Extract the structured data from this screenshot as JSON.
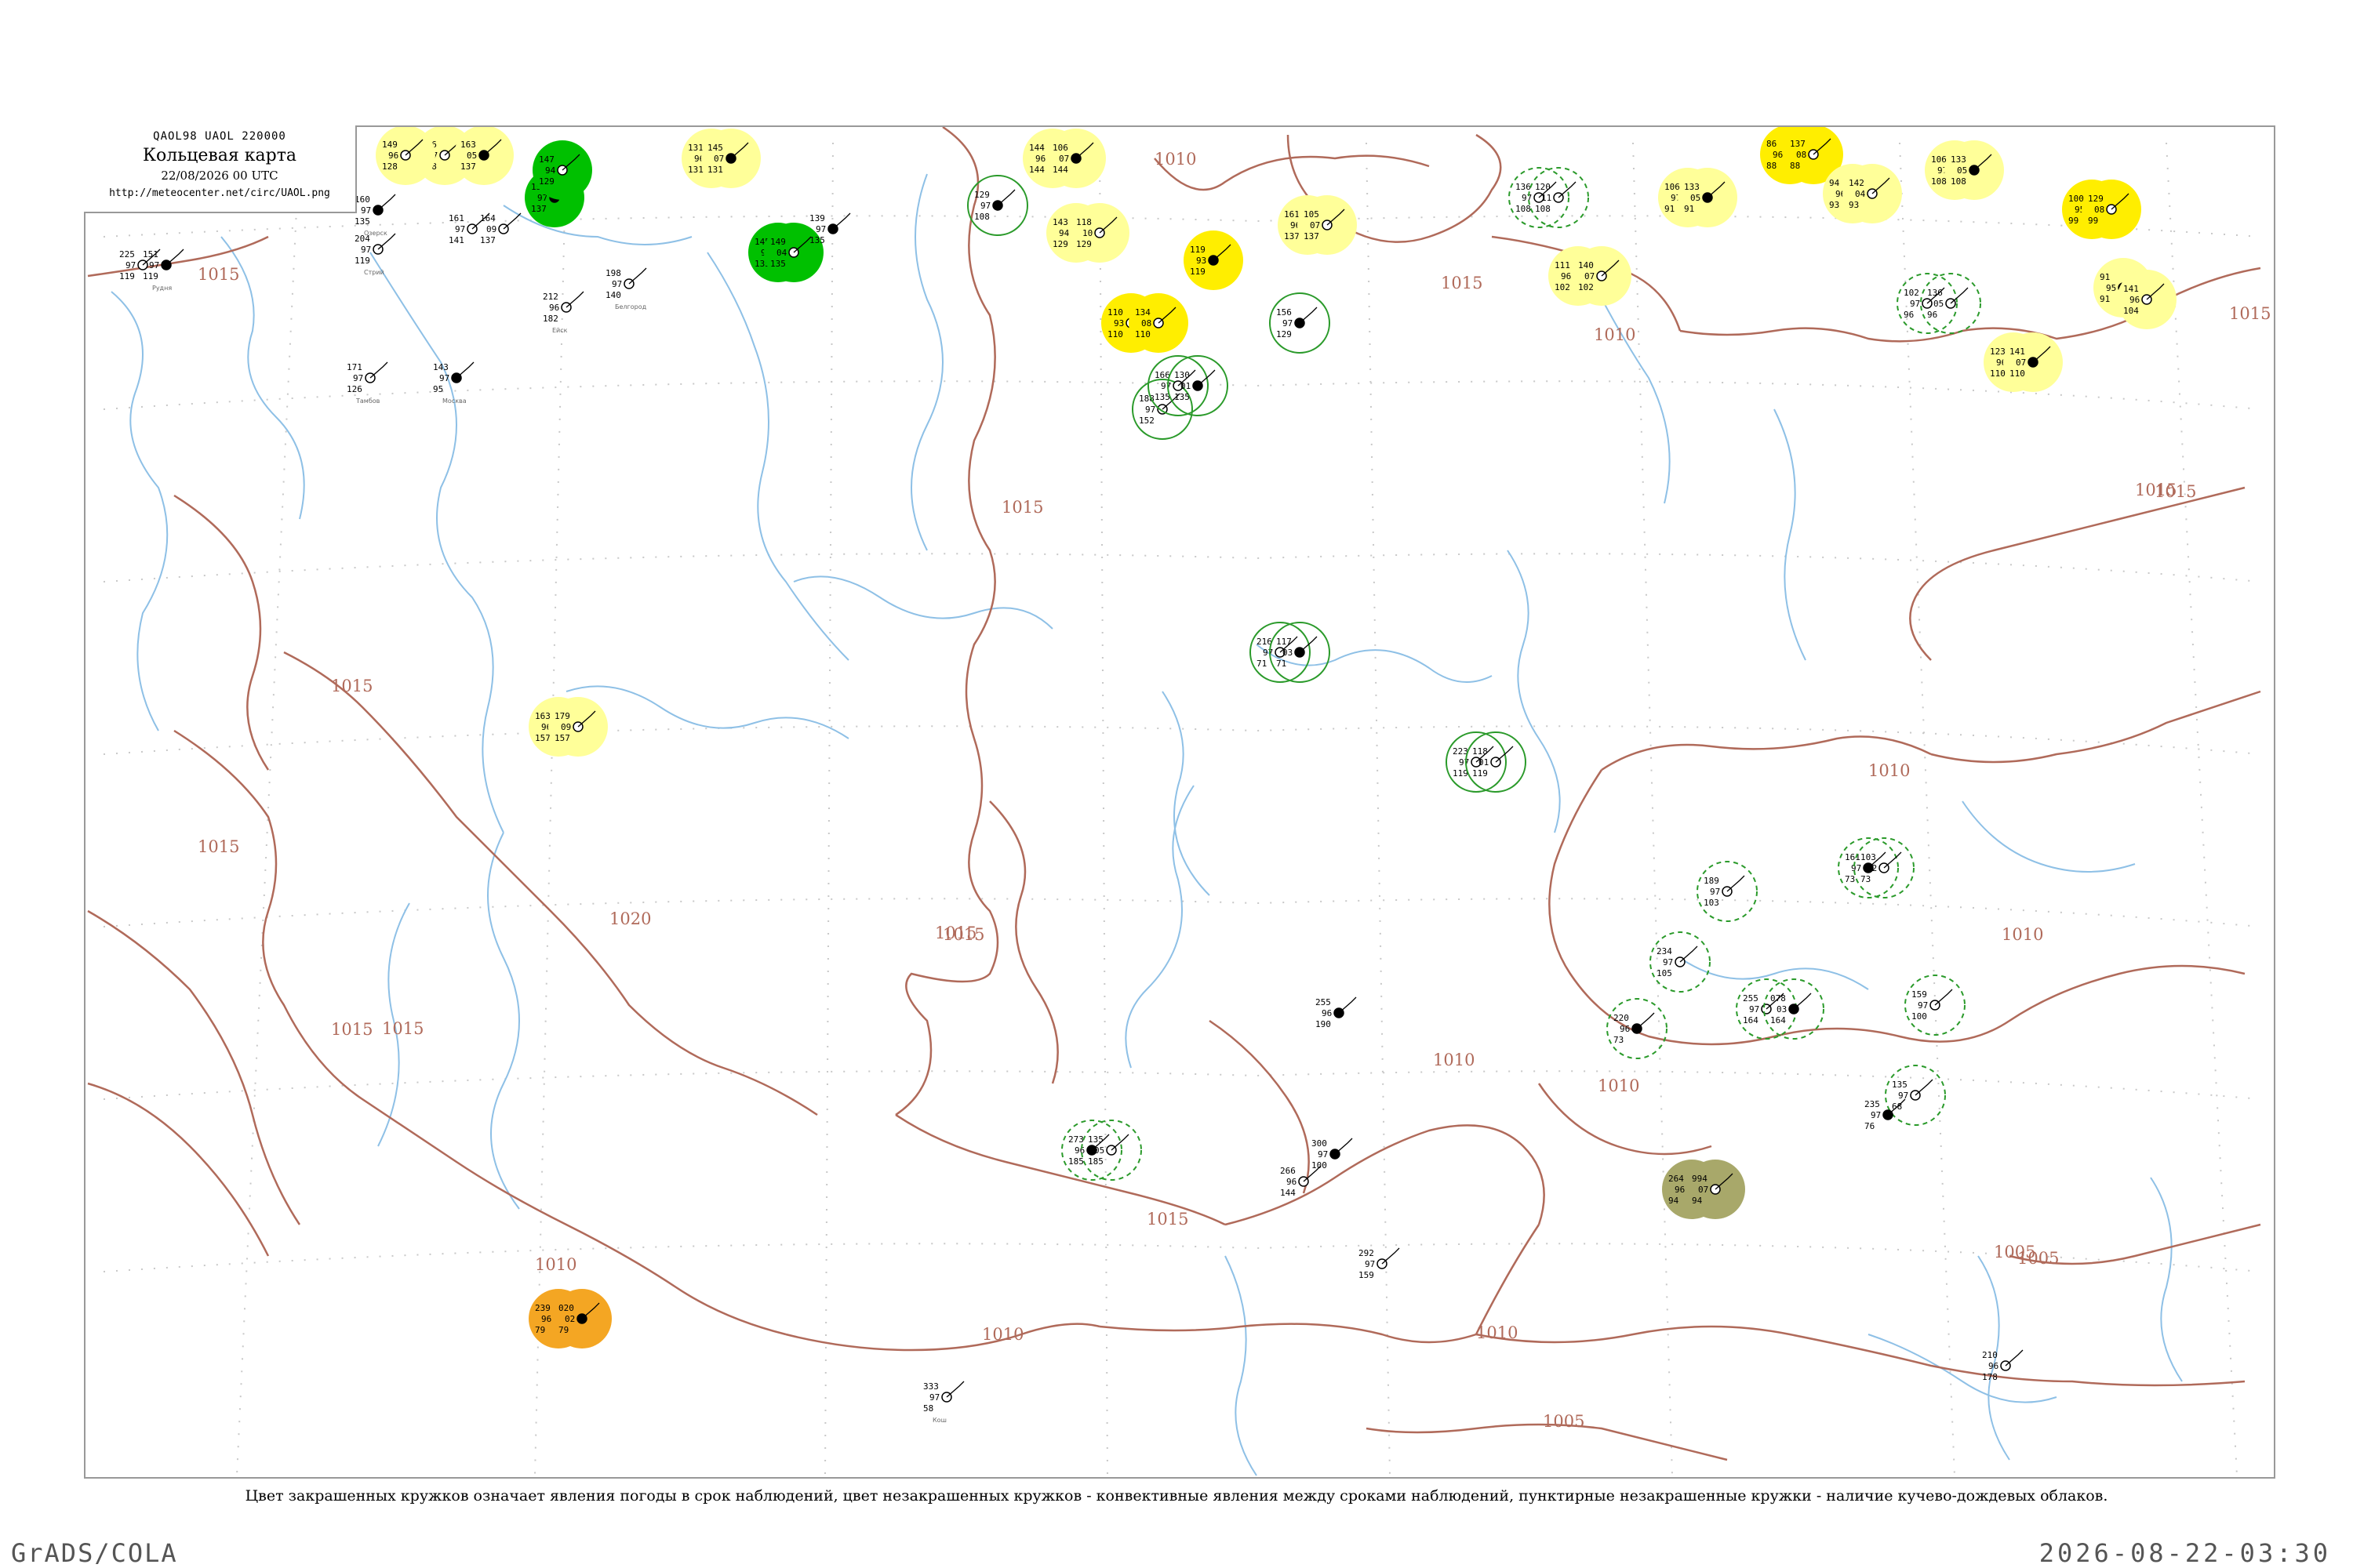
{
  "header": {
    "codes": "QAOL98  UAOL  220000",
    "title": "Кольцевая карта",
    "time": "22/08/2026 00 UTC",
    "url": "http://meteocenter.net/circ/UAOL.png"
  },
  "caption": "Цвет закрашенных кружков означает явления погоды в срок наблюдений, цвет незакрашенных кружков - конвективные явления между сроками наблюдений, пунктирные незакрашенные кружки - наличие кучево-дождевых облаков.",
  "footer": {
    "left": "GrADS/COLA",
    "right": "2026-08-22-03:30"
  },
  "colors": {
    "isobar": "#b06a5a",
    "river": "#8ec0e6",
    "rain": "#00c000",
    "drizzle_haze": "#ffff99",
    "fog": "#ffee00",
    "dust": "#f4a623",
    "smoke": "#a8a86a",
    "thunder_between": "#2a9a2a",
    "cb_dashed": "#2a9a2a"
  },
  "isobars": [
    {
      "label": "1015",
      "id": "i1"
    },
    {
      "label": "1010",
      "id": "i2"
    },
    {
      "label": "1015",
      "id": "i3"
    },
    {
      "label": "1015",
      "id": "i4"
    },
    {
      "label": "1015",
      "id": "i5"
    },
    {
      "label": "1010",
      "id": "i6"
    },
    {
      "label": "1010",
      "id": "i7"
    },
    {
      "label": "1015",
      "id": "i8"
    },
    {
      "label": "1015",
      "id": "i9"
    },
    {
      "label": "1005",
      "id": "i10"
    },
    {
      "label": "1020",
      "id": "i11"
    },
    {
      "label": "1015",
      "id": "i12"
    },
    {
      "label": "1010",
      "id": "i13"
    },
    {
      "label": "1015",
      "id": "i14"
    },
    {
      "label": "1010",
      "id": "i15"
    },
    {
      "label": "1010",
      "id": "i16"
    },
    {
      "label": "1005",
      "id": "i17"
    },
    {
      "label": "1005",
      "id": "i18"
    },
    {
      "label": "1015",
      "id": "i19"
    },
    {
      "label": "1015",
      "id": "i20"
    },
    {
      "label": "1010",
      "id": "i21"
    },
    {
      "label": "1010",
      "id": "i22"
    },
    {
      "label": "1015",
      "id": "i23"
    },
    {
      "label": "1015",
      "id": "i24"
    },
    {
      "label": "1010",
      "id": "i25"
    },
    {
      "label": "1015",
      "id": "i26"
    }
  ],
  "stations": [
    {
      "t": "160",
      "d": "97",
      "p": "135",
      "name": "Озерск",
      "w": "none"
    },
    {
      "t": "204",
      "d": "97",
      "p": "119",
      "name": "Стрий",
      "w": "none"
    },
    {
      "t": "225",
      "d": "97",
      "p": "119",
      "name": "",
      "w": "none"
    },
    {
      "t": "151",
      "d": "97",
      "p": "119",
      "name": "Рудня",
      "w": "none"
    },
    {
      "t": "146",
      "d": "97",
      "p": "128",
      "name": "",
      "w": "drizzle"
    },
    {
      "t": "149",
      "d": "96",
      "p": "128",
      "name": "",
      "w": "drizzle"
    },
    {
      "t": "163",
      "d": "05",
      "p": "137",
      "name": "",
      "w": "drizzle"
    },
    {
      "t": "161",
      "d": "97",
      "p": "141",
      "name": "",
      "w": "none"
    },
    {
      "t": "164",
      "d": "09",
      "p": "137",
      "name": "",
      "w": "none"
    },
    {
      "t": "154",
      "d": "97",
      "p": "137",
      "name": "",
      "w": "rain"
    },
    {
      "t": "147",
      "d": "94",
      "p": "129",
      "name": "",
      "w": "rain"
    },
    {
      "t": "131",
      "d": "96",
      "p": "131",
      "name": "",
      "w": "drizzle"
    },
    {
      "t": "145",
      "d": "07",
      "p": "131",
      "name": "",
      "w": "drizzle"
    },
    {
      "t": "145",
      "d": "97",
      "p": "135",
      "name": "",
      "w": "rain"
    },
    {
      "t": "149",
      "d": "04",
      "p": "135",
      "name": "",
      "w": "rain"
    },
    {
      "t": "139",
      "d": "97",
      "p": "135",
      "name": "",
      "w": "none"
    },
    {
      "t": "212",
      "d": "96",
      "p": "182",
      "name": "Ейск",
      "w": "none"
    },
    {
      "t": "198",
      "d": "97",
      "p": "140",
      "name": "Белгород",
      "w": "none"
    },
    {
      "t": "143",
      "d": "97",
      "p": "95",
      "name": "Москва",
      "w": "none"
    },
    {
      "t": "171",
      "d": "97",
      "p": "126",
      "name": "Тамбов",
      "w": "none"
    },
    {
      "t": "144",
      "d": "96",
      "p": "144",
      "name": "",
      "w": "drizzle"
    },
    {
      "t": "106",
      "d": "07",
      "p": "144",
      "name": "",
      "w": "drizzle"
    },
    {
      "t": "143",
      "d": "94",
      "p": "129",
      "name": "",
      "w": "drizzle"
    },
    {
      "t": "118",
      "d": "10",
      "p": "129",
      "name": "",
      "w": "drizzle"
    },
    {
      "t": "119",
      "d": "93",
      "p": "119",
      "name": "",
      "w": "fog"
    },
    {
      "t": "110",
      "d": "93",
      "p": "110",
      "name": "",
      "w": "fog"
    },
    {
      "t": "134",
      "d": "08",
      "p": "110",
      "name": "",
      "w": "fog"
    },
    {
      "t": "129",
      "d": "97",
      "p": "108",
      "name": "",
      "w": "tstorm"
    },
    {
      "t": "161",
      "d": "96",
      "p": "137",
      "name": "",
      "w": "drizzle"
    },
    {
      "t": "105",
      "d": "07",
      "p": "137",
      "name": "",
      "w": "drizzle"
    },
    {
      "t": "156",
      "d": "97",
      "p": "129",
      "name": "",
      "w": "tstorm"
    },
    {
      "t": "188",
      "d": "97",
      "p": "152",
      "name": "",
      "w": "tstorm"
    },
    {
      "t": "166",
      "d": "97",
      "p": "135",
      "name": "",
      "w": "tstorm"
    },
    {
      "t": "130",
      "d": "01",
      "p": "135",
      "name": "",
      "w": "tstorm"
    },
    {
      "t": "136",
      "d": "97",
      "p": "108",
      "name": "",
      "w": "cb"
    },
    {
      "t": "120",
      "d": "11",
      "p": "108",
      "name": "",
      "w": "cb"
    },
    {
      "t": "111",
      "d": "96",
      "p": "102",
      "name": "",
      "w": "drizzle"
    },
    {
      "t": "140",
      "d": "07",
      "p": "102",
      "name": "",
      "w": "drizzle"
    },
    {
      "t": "106",
      "d": "97",
      "p": "91",
      "name": "",
      "w": "drizzle"
    },
    {
      "t": "133",
      "d": "05",
      "p": "91",
      "name": "",
      "w": "drizzle"
    },
    {
      "t": "86",
      "d": "96",
      "p": "88",
      "name": "",
      "w": "fog"
    },
    {
      "t": "137",
      "d": "08",
      "p": "88",
      "name": "",
      "w": "fog"
    },
    {
      "t": "94",
      "d": "96",
      "p": "93",
      "name": "",
      "w": "drizzle"
    },
    {
      "t": "142",
      "d": "04",
      "p": "93",
      "name": "",
      "w": "drizzle"
    },
    {
      "t": "106",
      "d": "97",
      "p": "108",
      "name": "",
      "w": "drizzle"
    },
    {
      "t": "133",
      "d": "05",
      "p": "108",
      "name": "",
      "w": "drizzle"
    },
    {
      "t": "100",
      "d": "95",
      "p": "99",
      "name": "",
      "w": "fog"
    },
    {
      "t": "129",
      "d": "08",
      "p": "99",
      "name": "",
      "w": "fog"
    },
    {
      "t": "91",
      "d": "95",
      "p": "91",
      "name": "",
      "w": "drizzle"
    },
    {
      "t": "141",
      "d": "96",
      "p": "104",
      "name": "",
      "w": "drizzle"
    },
    {
      "t": "123",
      "d": "96",
      "p": "110",
      "name": "",
      "w": "drizzle"
    },
    {
      "t": "141",
      "d": "07",
      "p": "110",
      "name": "",
      "w": "drizzle"
    },
    {
      "t": "102",
      "d": "97",
      "p": "96",
      "name": "",
      "w": "cb"
    },
    {
      "t": "136",
      "d": "05",
      "p": "96",
      "name": "",
      "w": "cb"
    },
    {
      "t": "163",
      "d": "96",
      "p": "157",
      "name": "",
      "w": "drizzle"
    },
    {
      "t": "179",
      "d": "09",
      "p": "157",
      "name": "",
      "w": "drizzle"
    },
    {
      "t": "216",
      "d": "97",
      "p": "71",
      "name": "",
      "w": "tstorm"
    },
    {
      "t": "117",
      "d": "03",
      "p": "71",
      "name": "",
      "w": "tstorm"
    },
    {
      "t": "223",
      "d": "97",
      "p": "119",
      "name": "",
      "w": "tstorm"
    },
    {
      "t": "118",
      "d": "01",
      "p": "119",
      "name": "",
      "w": "tstorm"
    },
    {
      "t": "273",
      "d": "96",
      "p": "185",
      "name": "",
      "w": "cb"
    },
    {
      "t": "135",
      "d": "05",
      "p": "185",
      "name": "",
      "w": "cb"
    },
    {
      "t": "239",
      "d": "96",
      "p": "79",
      "name": "",
      "w": "dust"
    },
    {
      "t": "020",
      "d": "02",
      "p": "79",
      "name": "",
      "w": "dust"
    },
    {
      "t": "264",
      "d": "96",
      "p": "94",
      "name": "",
      "w": "smoke"
    },
    {
      "t": "994",
      "d": "07",
      "p": "94",
      "name": "",
      "w": "smoke"
    },
    {
      "t": "161",
      "d": "97",
      "p": "73",
      "name": "",
      "w": "cb"
    },
    {
      "t": "103",
      "d": "02",
      "p": "73",
      "name": "",
      "w": "cb"
    },
    {
      "t": "255",
      "d": "97",
      "p": "164",
      "name": "",
      "w": "cb"
    },
    {
      "t": "078",
      "d": "03",
      "p": "164",
      "name": "",
      "w": "cb"
    },
    {
      "t": "135",
      "d": "97",
      "p": "68",
      "name": "",
      "w": "cb"
    },
    {
      "t": "159",
      "d": "97",
      "p": "100",
      "name": "",
      "w": "cb"
    },
    {
      "t": "255",
      "d": "96",
      "p": "190",
      "name": "",
      "w": "none"
    },
    {
      "t": "292",
      "d": "97",
      "p": "159",
      "name": "",
      "w": "none"
    },
    {
      "t": "333",
      "d": "97",
      "p": "58",
      "name": "Кош",
      "w": "none"
    },
    {
      "t": "220",
      "d": "96",
      "p": "73",
      "name": "",
      "w": "cb"
    },
    {
      "t": "189",
      "d": "97",
      "p": "103",
      "name": "",
      "w": "cb"
    },
    {
      "t": "234",
      "d": "97",
      "p": "105",
      "name": "",
      "w": "cb"
    },
    {
      "t": "300",
      "d": "97",
      "p": "100",
      "name": "",
      "w": "none"
    },
    {
      "t": "266",
      "d": "96",
      "p": "144",
      "name": "",
      "w": "none"
    },
    {
      "t": "210",
      "d": "96",
      "p": "178",
      "name": "",
      "w": "none"
    },
    {
      "t": "235",
      "d": "97",
      "p": "76",
      "name": "",
      "w": "none"
    }
  ]
}
